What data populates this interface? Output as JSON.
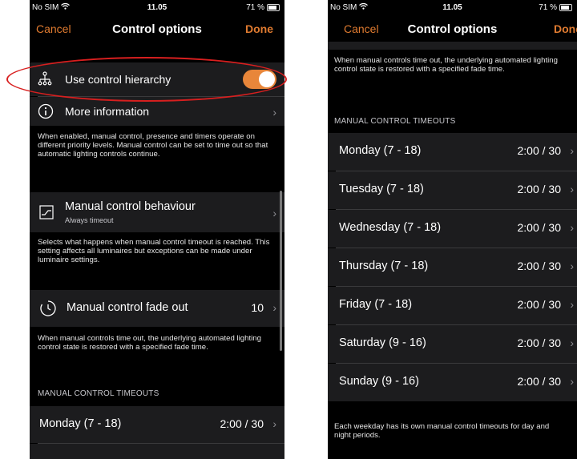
{
  "status": {
    "carrier": "No SIM",
    "time": "11.05",
    "battery": "71 %"
  },
  "nav": {
    "cancel": "Cancel",
    "title": "Control options",
    "done": "Done"
  },
  "left": {
    "hierarchy_label": "Use control hierarchy",
    "more_info_label": "More information",
    "hierarchy_note": "When enabled, manual control, presence and timers operate on different priority levels. Manual control can be set to time out so that automatic lighting controls continue.",
    "behaviour_label": "Manual control behaviour",
    "behaviour_sub": "Always timeout",
    "behaviour_note": "Selects what happens when manual control timeout is reached. This setting affects all luminaires but exceptions can be made under luminaire settings.",
    "fade_label": "Manual control fade out",
    "fade_value": "10",
    "fade_note": "When manual controls time out, the underlying automated lighting control state is restored with a specified fade time.",
    "section": "MANUAL CONTROL TIMEOUTS",
    "first_day": {
      "label": "Monday (7 - 18)",
      "value": "2:00 / 30"
    }
  },
  "right": {
    "top_note": "When manual controls time out, the underlying automated lighting control state is restored with a specified fade time.",
    "section": "MANUAL CONTROL TIMEOUTS",
    "days": [
      {
        "label": "Monday (7 - 18)",
        "value": "2:00 / 30"
      },
      {
        "label": "Tuesday (7 - 18)",
        "value": "2:00 / 30"
      },
      {
        "label": "Wednesday (7 - 18)",
        "value": "2:00 / 30"
      },
      {
        "label": "Thursday (7 - 18)",
        "value": "2:00 / 30"
      },
      {
        "label": "Friday (7 - 18)",
        "value": "2:00 / 30"
      },
      {
        "label": "Saturday (9 - 16)",
        "value": "2:00 / 30"
      },
      {
        "label": "Sunday (9 - 16)",
        "value": "2:00 / 30"
      }
    ],
    "bottom_note": "Each weekday has its own manual control timeouts for day and night periods."
  },
  "colors": {
    "accent": "#e07b30",
    "toggle_on": "#e8863a",
    "highlight": "#d81f1f"
  }
}
